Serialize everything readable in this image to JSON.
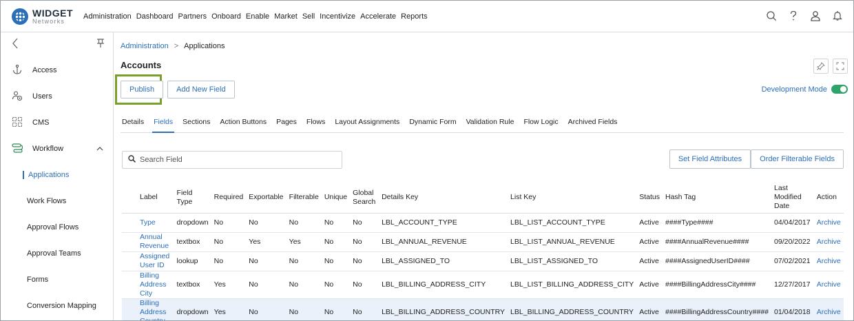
{
  "app": {
    "logo_main": "WIDGET",
    "logo_sub": "Networks"
  },
  "topnav": [
    "Administration",
    "Dashboard",
    "Partners",
    "Onboard",
    "Enable",
    "Market",
    "Sell",
    "Incentivize",
    "Accelerate",
    "Reports"
  ],
  "top_icons": [
    "search-icon",
    "help-icon",
    "user-icon",
    "notification-icon"
  ],
  "sidebar": {
    "items": [
      {
        "label": "Access",
        "icon": "anchor-icon"
      },
      {
        "label": "Users",
        "icon": "users-icon"
      },
      {
        "label": "CMS",
        "icon": "cms-icon"
      },
      {
        "label": "Workflow",
        "icon": "workflow-icon"
      }
    ],
    "subitems": [
      "Applications",
      "Work Flows",
      "Approval Flows",
      "Approval Teams",
      "Forms",
      "Conversion Mapping"
    ],
    "active_sub": "Applications"
  },
  "breadcrumb": {
    "parent": "Administration",
    "separator": ">",
    "current": "Applications"
  },
  "page_title": "Accounts",
  "buttons": {
    "publish": "Publish",
    "add_field": "Add New Field",
    "set_attrs": "Set Field Attributes",
    "order_fields": "Order Filterable Fields"
  },
  "dev_mode": {
    "label": "Development Mode",
    "on": true
  },
  "tabs": [
    "Details",
    "Fields",
    "Sections",
    "Action Buttons",
    "Pages",
    "Flows",
    "Layout Assignments",
    "Dynamic Form",
    "Validation Rule",
    "Flow Logic",
    "Archived Fields"
  ],
  "active_tab": "Fields",
  "search": {
    "placeholder": "Search Field"
  },
  "table": {
    "headers": [
      "Label",
      "Field Type",
      "Required",
      "Exportable",
      "Filterable",
      "Unique",
      "Global Search",
      "Details Key",
      "List Key",
      "Status",
      "Hash Tag",
      "Last Modified Date",
      "Action"
    ],
    "rows": [
      [
        "Type",
        "dropdown",
        "No",
        "No",
        "No",
        "No",
        "No",
        "LBL_ACCOUNT_TYPE",
        "LBL_LIST_ACCOUNT_TYPE",
        "Active",
        "####Type####",
        "04/04/2017",
        "Archive"
      ],
      [
        "Annual Revenue",
        "textbox",
        "No",
        "Yes",
        "Yes",
        "No",
        "No",
        "LBL_ANNUAL_REVENUE",
        "LBL_LIST_ANNUAL_REVENUE",
        "Active",
        "####AnnualRevenue####",
        "09/20/2022",
        "Archive"
      ],
      [
        "Assigned User ID",
        "lookup",
        "No",
        "No",
        "No",
        "No",
        "No",
        "LBL_ASSIGNED_TO",
        "LBL_LIST_ASSIGNED_TO",
        "Active",
        "####AssignedUserID####",
        "07/02/2021",
        "Archive"
      ],
      [
        "Billing Address City",
        "textbox",
        "Yes",
        "No",
        "No",
        "No",
        "No",
        "LBL_BILLING_ADDRESS_CITY",
        "LBL_LIST_BILLING_ADDRESS_CITY",
        "Active",
        "####BillingAddressCity####",
        "12/27/2017",
        "Archive"
      ],
      [
        "Billing Address Country",
        "dropdown",
        "Yes",
        "No",
        "No",
        "No",
        "No",
        "LBL_BILLING_ADDRESS_COUNTRY",
        "LBL_BILLING_ADDRESS_COUNTRY",
        "Active",
        "####BillingAddressCountry####",
        "01/04/2018",
        "Archive"
      ]
    ]
  }
}
